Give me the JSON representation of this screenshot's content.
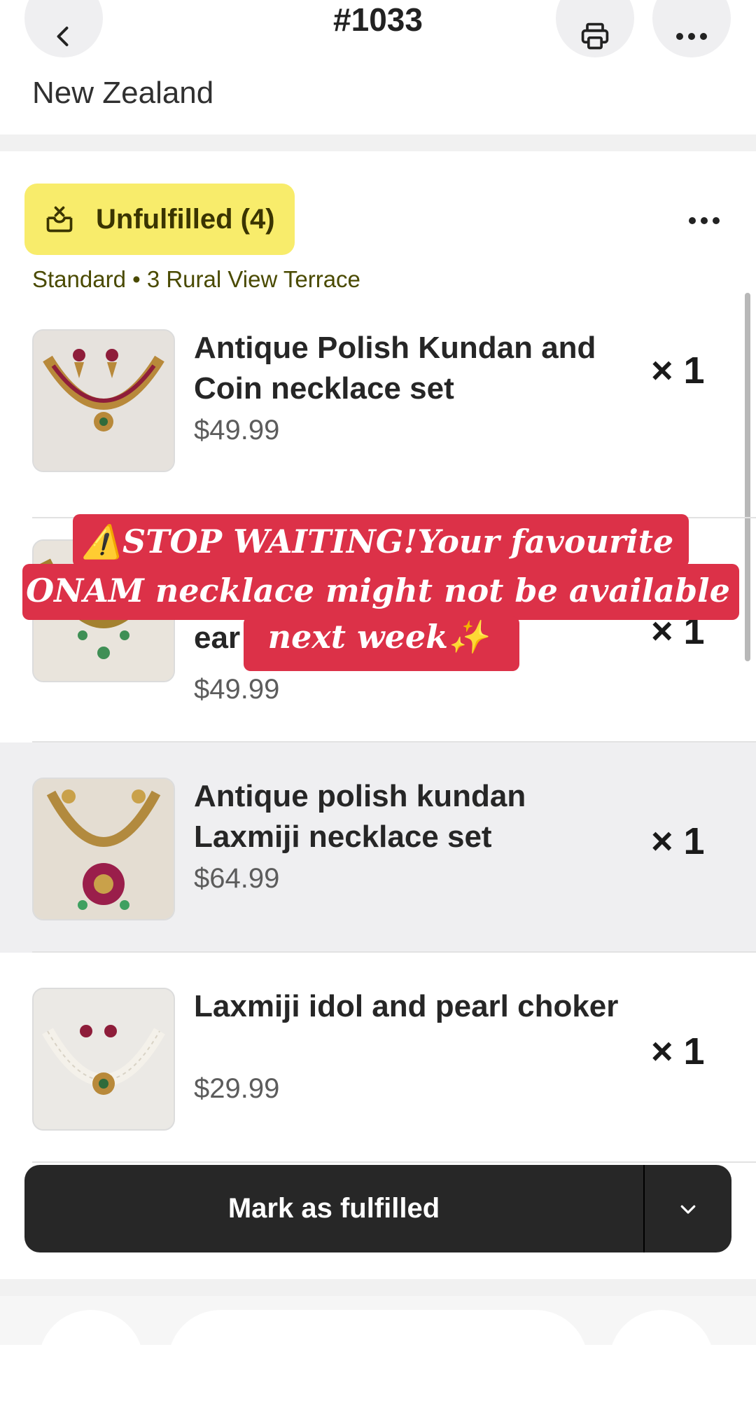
{
  "header": {
    "order_number": "#1033",
    "country": "New Zealand"
  },
  "fulfillment": {
    "status_label": "Unfulfilled (4)",
    "shipping_line": "Standard • 3 Rural View Terrace",
    "items": [
      {
        "title": "Antique Polish Kundan and Coin necklace set",
        "price": "$49.99",
        "quantity": "× 1"
      },
      {
        "title": "ear",
        "price": "$49.99",
        "quantity": "× 1"
      },
      {
        "title": "Antique polish kundan Laxmiji necklace set",
        "price": "$64.99",
        "quantity": "× 1"
      },
      {
        "title": "Laxmiji idol and pearl choker",
        "price": "$29.99",
        "quantity": "× 1"
      }
    ]
  },
  "promo": {
    "line1": "⚠️STOP WAITING!Your favourite",
    "line2": "ONAM necklace might not be available",
    "line3": "next week✨"
  },
  "actions": {
    "mark_fulfilled_label": "Mark as fulfilled"
  },
  "icons": {
    "back": "chevron-left-icon",
    "print": "printer-icon",
    "more": "ellipsis-icon",
    "status": "unfulfilled-box-icon",
    "dropdown": "chevron-down-icon"
  },
  "colors": {
    "status_badge": "#f8ec6b",
    "promo_banner": "#dc3148",
    "primary_button": "#272727"
  }
}
